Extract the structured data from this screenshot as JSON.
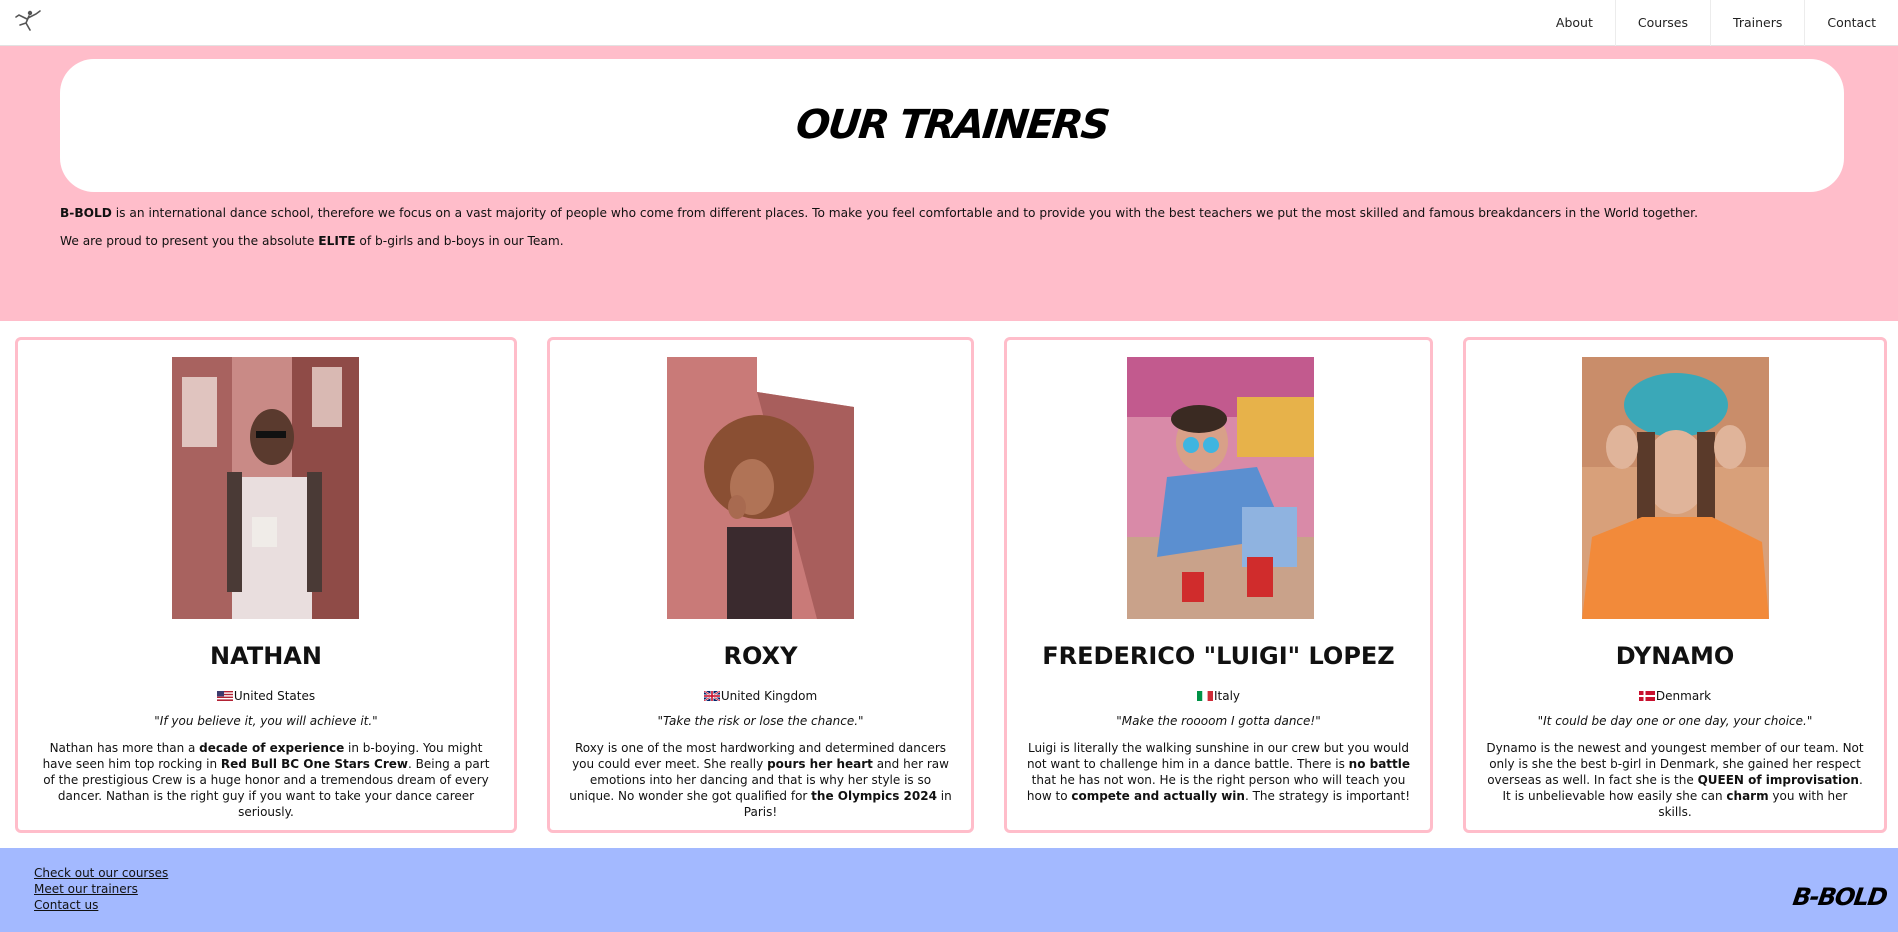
{
  "nav": {
    "logo_icon": "dancer-logo-icon",
    "links": [
      "About",
      "Courses",
      "Trainers",
      "Contact"
    ]
  },
  "hero": {
    "title": "OUR TRAINERS",
    "p1": {
      "brand": "B-BOLD",
      "text": " is an international dance school, therefore we focus on a vast majority of people who come from different places. To make you feel comfortable and to provide you with the best teachers we put the most skilled and famous breakdancers in the World together."
    },
    "p2": {
      "before": "We are proud to present you the absolute ",
      "bold": "ELITE",
      "after": " of b-girls and b-boys in our Team."
    }
  },
  "trainers": [
    {
      "name": "NATHAN",
      "flag": "us-flag-icon",
      "country": "United States",
      "quote": "\"If you believe it, you will achieve it.\"",
      "desc": [
        {
          "t": "Nathan has more than a "
        },
        {
          "b": "decade of experience"
        },
        {
          "t": " in b-boying. You might have seen him top rocking in "
        },
        {
          "b": "Red Bull BC One Stars Crew"
        },
        {
          "t": ". Being a part of the prestigious Crew is a huge honor and a tremendous dream of every dancer. Nathan is the right guy if you want to take your dance career seriously."
        }
      ]
    },
    {
      "name": "ROXY",
      "flag": "uk-flag-icon",
      "country": "United Kingdom",
      "quote": "\"Take the risk or lose the chance.\"",
      "desc": [
        {
          "t": "Roxy is one of the most hardworking and determined dancers you could ever meet. She really "
        },
        {
          "b": "pours her heart"
        },
        {
          "t": " and her raw emotions into her dancing and that is why her style is so unique. No wonder she got qualified for "
        },
        {
          "b": "the Olympics 2024"
        },
        {
          "t": " in Paris!"
        }
      ]
    },
    {
      "name": "FREDERICO \"LUIGI\" LOPEZ",
      "flag": "italy-flag-icon",
      "country": "Italy",
      "quote": "\"Make the roooom I gotta dance!\"",
      "desc": [
        {
          "t": "Luigi is literally the walking sunshine in our crew but you would not want to challenge him in a dance battle. There is "
        },
        {
          "b": "no battle"
        },
        {
          "t": " that he has not won. He is the right person who will teach you how to "
        },
        {
          "b": "compete and actually win"
        },
        {
          "t": ". The strategy is important!"
        }
      ]
    },
    {
      "name": "DYNAMO",
      "flag": "denmark-flag-icon",
      "country": "Denmark",
      "quote": "\"It could be day one or one day, your choice.\"",
      "desc": [
        {
          "t": "Dynamo is the newest and youngest member of our team. Not only is she the best b-girl in Denmark, she gained her respect overseas as well. In fact she is the "
        },
        {
          "b": "QUEEN of improvisation"
        },
        {
          "t": ". It is unbelievable how easily she can "
        },
        {
          "b": "charm"
        },
        {
          "t": " you with her skills."
        }
      ]
    }
  ],
  "footer": {
    "links": [
      "Check out our courses",
      "Meet our trainers",
      "Contact us"
    ],
    "brand": "B-BOLD"
  },
  "colors": {
    "pink": "#ffbdca",
    "footer_blue": "#a3b9ff"
  }
}
